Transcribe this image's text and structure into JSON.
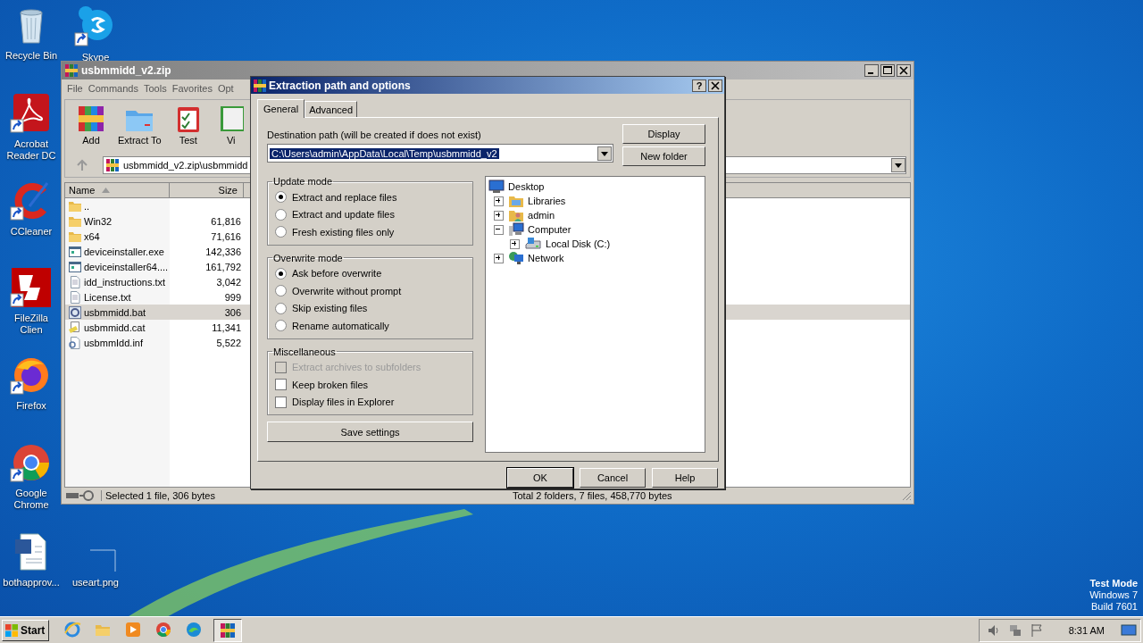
{
  "desktop_icons": [
    {
      "label": "Recycle Bin",
      "kind": "recycle",
      "shortcut": false
    },
    {
      "label": "Skype",
      "kind": "skype",
      "shortcut": true
    },
    {
      "label": "Acrobat Reader DC",
      "kind": "acrobat",
      "shortcut": true
    },
    {
      "label": "CCleaner",
      "kind": "ccleaner",
      "shortcut": true
    },
    {
      "label": "FileZilla Clien",
      "kind": "filezilla",
      "shortcut": true
    },
    {
      "label": "Firefox",
      "kind": "firefox",
      "shortcut": true
    },
    {
      "label": "Google Chrome",
      "kind": "chrome",
      "shortcut": true
    },
    {
      "label": "bothapprov...",
      "kind": "word",
      "shortcut": false
    },
    {
      "label": "useart.png",
      "kind": "image",
      "shortcut": false
    }
  ],
  "system_notice": [
    "Test Mode",
    "Windows 7",
    "Build 7601"
  ],
  "archive_window": {
    "title": "usbmmidd_v2.zip",
    "menu": [
      "File",
      "Commands",
      "Tools",
      "Favorites",
      "Opt"
    ],
    "toolbar": [
      {
        "label": "Add",
        "kind": "add"
      },
      {
        "label": "Extract To",
        "kind": "extract"
      },
      {
        "label": "Test",
        "kind": "test"
      },
      {
        "label": "Vi",
        "kind": "view"
      }
    ],
    "address": "usbmmidd_v2.zip\\usbmmidd",
    "columns": [
      "Name",
      "Size"
    ],
    "rows": [
      {
        "name": "..",
        "size": "",
        "kind": "folder",
        "selected": false
      },
      {
        "name": "Win32",
        "size": "61,816",
        "kind": "folder",
        "selected": false
      },
      {
        "name": "x64",
        "size": "71,616",
        "kind": "folder",
        "selected": false
      },
      {
        "name": "deviceinstaller.exe",
        "size": "142,336",
        "kind": "exe",
        "selected": false
      },
      {
        "name": "deviceinstaller64....",
        "size": "161,792",
        "kind": "exe",
        "selected": false
      },
      {
        "name": "idd_instructions.txt",
        "size": "3,042",
        "kind": "txt",
        "selected": false
      },
      {
        "name": "License.txt",
        "size": "999",
        "kind": "txt",
        "selected": false
      },
      {
        "name": "usbmmidd.bat",
        "size": "306",
        "kind": "bat",
        "selected": true
      },
      {
        "name": "usbmmidd.cat",
        "size": "11,341",
        "kind": "cat",
        "selected": false
      },
      {
        "name": "usbmmIdd.inf",
        "size": "5,522",
        "kind": "inf",
        "selected": false
      }
    ],
    "status_left": "Selected 1 file, 306 bytes",
    "status_right": "Total 2 folders, 7 files, 458,770 bytes"
  },
  "dialog": {
    "title": "Extraction path and options",
    "help_button": "?",
    "tabs": [
      {
        "label": "General",
        "selected": true
      },
      {
        "label": "Advanced",
        "selected": false
      }
    ],
    "path_label": "Destination path (will be created if does not exist)",
    "path_value": "C:\\Users\\admin\\AppData\\Local\\Temp\\usbmmidd_v2",
    "side_buttons": [
      "Display",
      "New folder"
    ],
    "update_mode": {
      "title": "Update mode",
      "options": [
        {
          "label": "Extract and replace files",
          "selected": true
        },
        {
          "label": "Extract and update files",
          "selected": false
        },
        {
          "label": "Fresh existing files only",
          "selected": false
        }
      ]
    },
    "overwrite_mode": {
      "title": "Overwrite mode",
      "options": [
        {
          "label": "Ask before overwrite",
          "selected": true
        },
        {
          "label": "Overwrite without prompt",
          "selected": false
        },
        {
          "label": "Skip existing files",
          "selected": false
        },
        {
          "label": "Rename automatically",
          "selected": false
        }
      ]
    },
    "miscellaneous": {
      "title": "Miscellaneous",
      "options": [
        {
          "label": "Extract archives to subfolders",
          "checked": false,
          "disabled": true
        },
        {
          "label": "Keep broken files",
          "checked": false,
          "disabled": false
        },
        {
          "label": "Display files in Explorer",
          "checked": false,
          "disabled": false
        }
      ]
    },
    "save_button": "Save settings",
    "tree": {
      "label": "Desktop",
      "kind": "desktop",
      "children": [
        {
          "label": "Libraries",
          "kind": "libraries",
          "expanded": false
        },
        {
          "label": "admin",
          "kind": "user",
          "expanded": false
        },
        {
          "label": "Computer",
          "kind": "computer",
          "expanded": true,
          "children": [
            {
              "label": "Local Disk (C:)",
              "kind": "disk",
              "expanded": false
            }
          ]
        },
        {
          "label": "Network",
          "kind": "network",
          "expanded": false
        }
      ]
    },
    "buttons": [
      {
        "label": "OK",
        "default": true
      },
      {
        "label": "Cancel",
        "default": false
      },
      {
        "label": "Help",
        "default": false
      }
    ]
  },
  "taskbar": {
    "start": "Start",
    "apps": [
      {
        "kind": "ie",
        "active": false
      },
      {
        "kind": "explorer",
        "active": false
      },
      {
        "kind": "media",
        "active": false
      },
      {
        "kind": "chrome",
        "active": false
      },
      {
        "kind": "edge",
        "active": false
      },
      {
        "kind": "winrar",
        "active": true
      }
    ],
    "clock": "8:31 AM"
  }
}
